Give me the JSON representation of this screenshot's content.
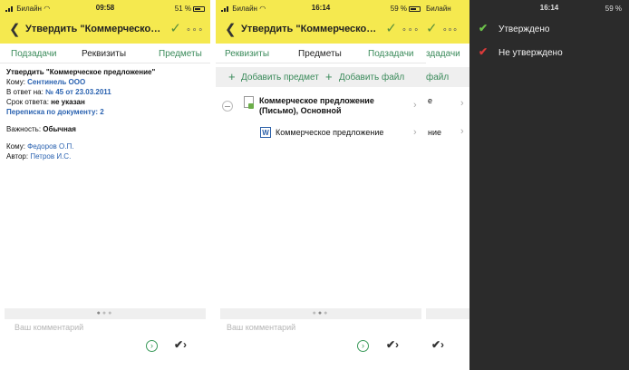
{
  "status1": {
    "carrier": "Билайн",
    "time": "09:58",
    "battery": "51 %"
  },
  "status2": {
    "carrier": "Билайн",
    "time": "16:14",
    "battery": "59 %"
  },
  "status3": {
    "carrier": "Билайн"
  },
  "status4": {
    "time": "16:14",
    "battery": "59 %"
  },
  "nav": {
    "title": "Утвердить \"Коммерческое...",
    "more": "∘∘∘"
  },
  "tabs1": [
    "Подзадачи",
    "Реквизиты",
    "Предметы"
  ],
  "tabs2": [
    "Реквизиты",
    "Предметы",
    "Подзадачи"
  ],
  "details": {
    "heading": "Утвердить \"Коммерческое предложение\"",
    "to_label": "Кому:",
    "to_value": "Сентинель ООО",
    "reply_label": "В ответ на:",
    "reply_value": "№ 45 от 23.03.2011",
    "due_label": "Срок ответа:",
    "due_value": "не указан",
    "correspondence": "Переписка по документу: 2",
    "importance_label": "Важность:",
    "importance_value": "Обычная",
    "recipient_label": "Кому:",
    "recipient_value": "Федоров О.П.",
    "author_label": "Автор:",
    "author_value": "Петров И.С."
  },
  "subjects": {
    "add_subject": "Добавить предмет",
    "add_file": "Добавить файл",
    "item_title_line1": "Коммерческое предложение",
    "item_title_line2": "(Письмо), Основной",
    "file_icon_letter": "W",
    "file_name": "Коммерческое предложение"
  },
  "partial": {
    "tab": "здадачи",
    "bar": "файл",
    "frag1": "е",
    "frag2": "ние"
  },
  "comment_placeholder": "Ваш комментарий",
  "options": [
    "Утверждено",
    "Не утверждено"
  ],
  "colors": {
    "yellow": "#f5e94f",
    "green": "#3a8a5a",
    "link": "#2a62b0",
    "dark": "#2b2b2b",
    "approved": "#6cc04a",
    "rejected": "#d93a3a"
  }
}
